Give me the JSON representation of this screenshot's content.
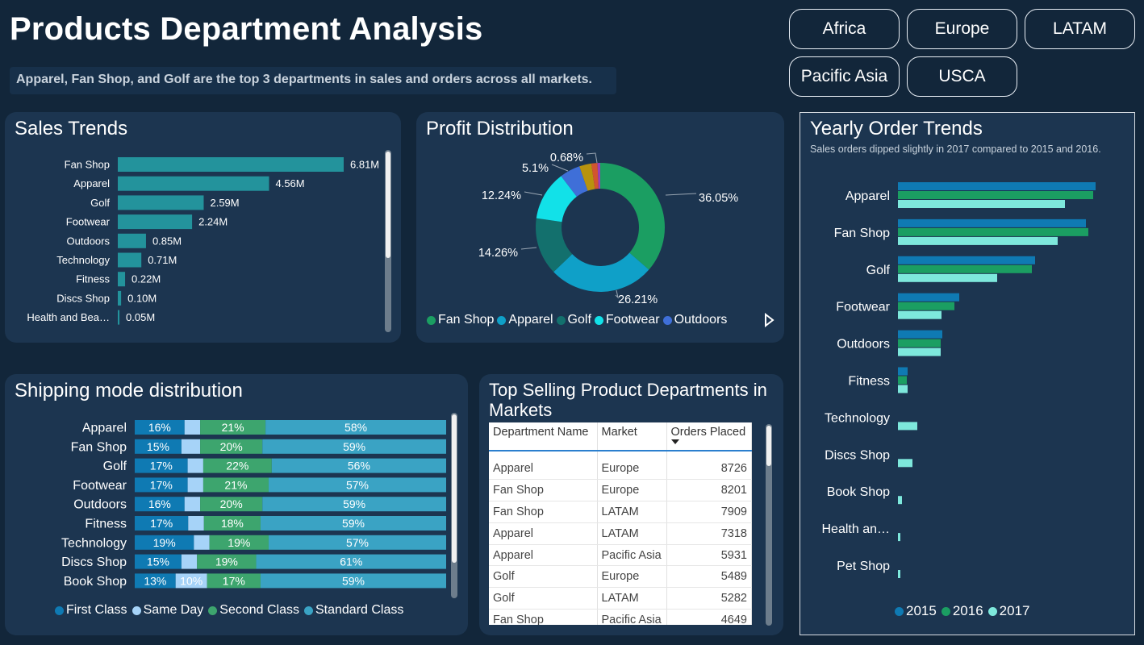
{
  "header": {
    "title": "Products Department Analysis",
    "subtitle": "Apparel, Fan Shop, and Golf are the top 3 departments in sales and orders across all markets."
  },
  "market_buttons": [
    "Africa",
    "Europe",
    "LATAM",
    "Pacific Asia",
    "USCA"
  ],
  "colors": {
    "background": "#12263a",
    "panel": "#1c3550",
    "teal_bar": "#23939c",
    "first_class": "#0f7ab3",
    "same_day": "#a6d3f8",
    "second_class": "#3da56e",
    "standard_class": "#3aa3c4",
    "y2015": "#0f7ab3",
    "y2016": "#1b9e62",
    "y2017": "#7ee8dc"
  },
  "panels": {
    "sales_title": "Sales Trends",
    "profit_title": "Profit Distribution",
    "shipping_title": "Shipping mode distribution",
    "top_title": "Top Selling Product Departments in Markets",
    "yearly_title": "Yearly Order Trends",
    "yearly_subtitle": "Sales orders dipped slightly in 2017 compared to 2015 and 2016."
  },
  "chart_data": [
    {
      "id": "sales_trends",
      "type": "bar",
      "orientation": "horizontal",
      "title": "Sales Trends",
      "categories": [
        "Fan Shop",
        "Apparel",
        "Golf",
        "Footwear",
        "Outdoors",
        "Technology",
        "Fitness",
        "Discs Shop",
        "Health and Bea…"
      ],
      "values": [
        6.81,
        4.56,
        2.59,
        2.24,
        0.85,
        0.71,
        0.22,
        0.1,
        0.05
      ],
      "labels": [
        "6.81M",
        "4.56M",
        "2.59M",
        "2.24M",
        "0.85M",
        "0.71M",
        "0.22M",
        "0.10M",
        "0.05M"
      ],
      "unit": "M",
      "xlim": [
        0,
        7.3
      ]
    },
    {
      "id": "profit_distribution",
      "type": "pie",
      "variant": "donut",
      "title": "Profit Distribution",
      "slices": [
        {
          "name": "Fan Shop",
          "value": 36.05,
          "label": "36.05%",
          "color": "#1b9e62"
        },
        {
          "name": "Apparel",
          "value": 26.21,
          "label": "26.21%",
          "color": "#0fa0c8"
        },
        {
          "name": "Golf",
          "value": 14.26,
          "label": "14.26%",
          "color": "#13706d"
        },
        {
          "name": "Footwear",
          "value": 12.24,
          "label": "12.24%",
          "color": "#12e1e8"
        },
        {
          "name": "Outdoors",
          "value": 5.1,
          "label": "5.1%",
          "color": "#3f6fd8"
        },
        {
          "name": "Fitness",
          "value": 3.0,
          "label": "",
          "color": "#b8930e"
        },
        {
          "name": "Technology",
          "value": 1.5,
          "label": "",
          "color": "#d2552f"
        },
        {
          "name": "Discs Shop",
          "value": 0.68,
          "label": "0.68%",
          "color": "#9b3fb8"
        }
      ],
      "legend": [
        "Fan Shop",
        "Apparel",
        "Golf",
        "Footwear",
        "Outdoors"
      ],
      "legend_position": "bottom"
    },
    {
      "id": "shipping_mode",
      "type": "bar",
      "orientation": "horizontal",
      "stacked": "100%",
      "title": "Shipping mode distribution",
      "categories": [
        "Apparel",
        "Fan Shop",
        "Golf",
        "Footwear",
        "Outdoors",
        "Fitness",
        "Technology",
        "Discs Shop",
        "Book Shop"
      ],
      "series": [
        {
          "name": "First Class",
          "values": [
            16,
            15,
            17,
            17,
            16,
            17,
            19,
            15,
            13
          ]
        },
        {
          "name": "Same Day",
          "values": [
            5,
            6,
            5,
            5,
            5,
            5,
            5,
            5,
            10
          ]
        },
        {
          "name": "Second Class",
          "values": [
            21,
            20,
            22,
            21,
            20,
            18,
            19,
            19,
            17
          ]
        },
        {
          "name": "Standard Class",
          "values": [
            58,
            59,
            56,
            57,
            59,
            59,
            57,
            61,
            59
          ]
        }
      ],
      "value_labels_shown": {
        "First Class": [
          "16%",
          "15%",
          "17%",
          "17%",
          "16%",
          "17%",
          "19%",
          "15%",
          "13%"
        ],
        "Same Day": [
          "",
          "",
          "",
          "",
          "",
          "",
          "",
          "",
          "10%"
        ],
        "Second Class": [
          "21%",
          "20%",
          "22%",
          "21%",
          "20%",
          "18%",
          "19%",
          "19%",
          "17%"
        ],
        "Standard Class": [
          "58%",
          "59%",
          "56%",
          "57%",
          "59%",
          "59%",
          "57%",
          "61%",
          "59%"
        ]
      },
      "legend_position": "bottom"
    },
    {
      "id": "top_selling",
      "type": "table",
      "title": "Top Selling Product Departments in Markets",
      "columns": [
        "Department Name",
        "Market",
        "Orders Placed"
      ],
      "sort": "Orders Placed descending",
      "rows": [
        [
          "Apparel",
          "Europe",
          8726
        ],
        [
          "Fan Shop",
          "Europe",
          8201
        ],
        [
          "Fan Shop",
          "LATAM",
          7909
        ],
        [
          "Apparel",
          "LATAM",
          7318
        ],
        [
          "Apparel",
          "Pacific Asia",
          5931
        ],
        [
          "Golf",
          "Europe",
          5489
        ],
        [
          "Golf",
          "LATAM",
          5282
        ],
        [
          "Fan Shop",
          "Pacific Asia",
          4649
        ]
      ]
    },
    {
      "id": "yearly_orders",
      "type": "bar",
      "orientation": "horizontal",
      "title": "Yearly Order Trends",
      "subtitle": "Sales orders dipped slightly in 2017 compared to 2015 and 2016.",
      "categories": [
        "Apparel",
        "Fan Shop",
        "Golf",
        "Footwear",
        "Outdoors",
        "Fitness",
        "Technology",
        "Discs Shop",
        "Book Shop",
        "Health an…",
        "Pet Shop"
      ],
      "series": [
        {
          "name": "2015",
          "values": [
            245,
            233,
            170,
            76,
            55,
            12,
            0,
            0,
            0,
            0,
            0
          ]
        },
        {
          "name": "2016",
          "values": [
            242,
            236,
            166,
            70,
            53,
            11,
            0,
            0,
            0,
            0,
            0
          ]
        },
        {
          "name": "2017",
          "values": [
            207,
            198,
            123,
            54,
            53,
            12,
            24,
            18,
            5,
            3,
            3
          ]
        }
      ],
      "legend_position": "bottom"
    }
  ]
}
